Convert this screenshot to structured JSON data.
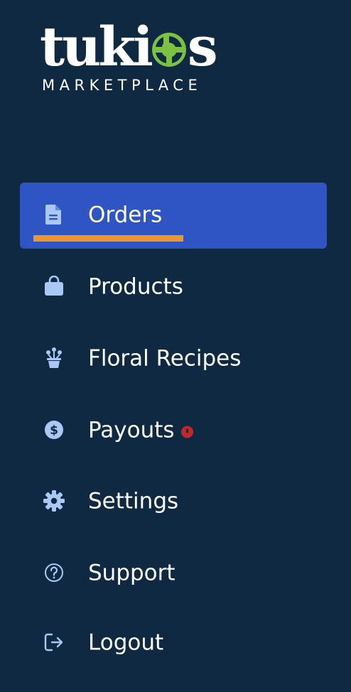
{
  "brand": {
    "wordmark_left": "tuki",
    "wordmark_right": "s",
    "subtitle": "MARKETPLACE",
    "accent_green": "#7bc142"
  },
  "nav": {
    "active": "orders",
    "items": [
      {
        "key": "orders",
        "label": "Orders",
        "icon": "document-icon"
      },
      {
        "key": "products",
        "label": "Products",
        "icon": "shopping-bag-icon"
      },
      {
        "key": "floral-recipes",
        "label": "Floral Recipes",
        "icon": "flower-pot-icon"
      },
      {
        "key": "payouts",
        "label": "Payouts",
        "icon": "dollar-circle-icon",
        "alert": true
      },
      {
        "key": "settings",
        "label": "Settings",
        "icon": "gear-icon"
      },
      {
        "key": "support",
        "label": "Support",
        "icon": "question-circle-icon"
      },
      {
        "key": "logout",
        "label": "Logout",
        "icon": "logout-icon"
      }
    ]
  },
  "colors": {
    "background": "#0f2942",
    "active_item": "#2f55c4",
    "active_underline": "#f1962a",
    "icon": "#a9c8f5",
    "alert": "#c0282d"
  }
}
